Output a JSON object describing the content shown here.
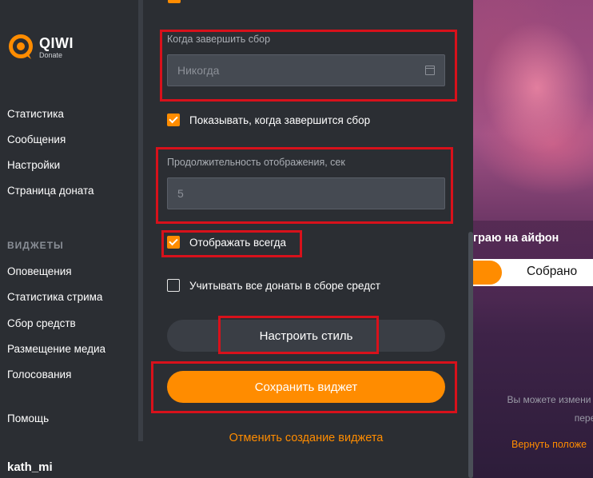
{
  "brand": {
    "name": "QIWI",
    "sub": "Donate"
  },
  "sidebar": {
    "items": [
      {
        "label": "Статистика"
      },
      {
        "label": "Сообщения"
      },
      {
        "label": "Настройки"
      },
      {
        "label": "Страница доната"
      }
    ],
    "section_title": "ВИДЖЕТЫ",
    "widgets": [
      {
        "label": "Оповещения"
      },
      {
        "label": "Статистика стрима"
      },
      {
        "label": "Сбор средств"
      },
      {
        "label": "Размещение медиа"
      },
      {
        "label": "Голосования"
      }
    ],
    "help": "Помощь",
    "username": "kath_mi"
  },
  "form": {
    "end_date": {
      "label": "Когда завершить сбор",
      "placeholder": "Никогда"
    },
    "show_on_finish": {
      "label": "Показывать, когда завершится сбор",
      "checked": true
    },
    "duration": {
      "label": "Продолжительность отображения, сек",
      "placeholder": "5"
    },
    "always_show": {
      "label": "Отображать всегда",
      "checked": true
    },
    "count_all": {
      "label": "Учитывать все донаты в сборе средст",
      "checked": false
    },
    "style_button": "Настроить стиль",
    "save_button": "Сохранить виджет",
    "cancel_link": "Отменить создание виджета"
  },
  "preview": {
    "title": "граю на айфон",
    "progress_label": "Собрано",
    "hint_line1": "Вы можете измени",
    "hint_line2": "пере",
    "link": "Вернуть положе"
  },
  "colors": {
    "accent": "#ff8c00",
    "highlight": "#d8111b",
    "background": "#2b2e33"
  }
}
